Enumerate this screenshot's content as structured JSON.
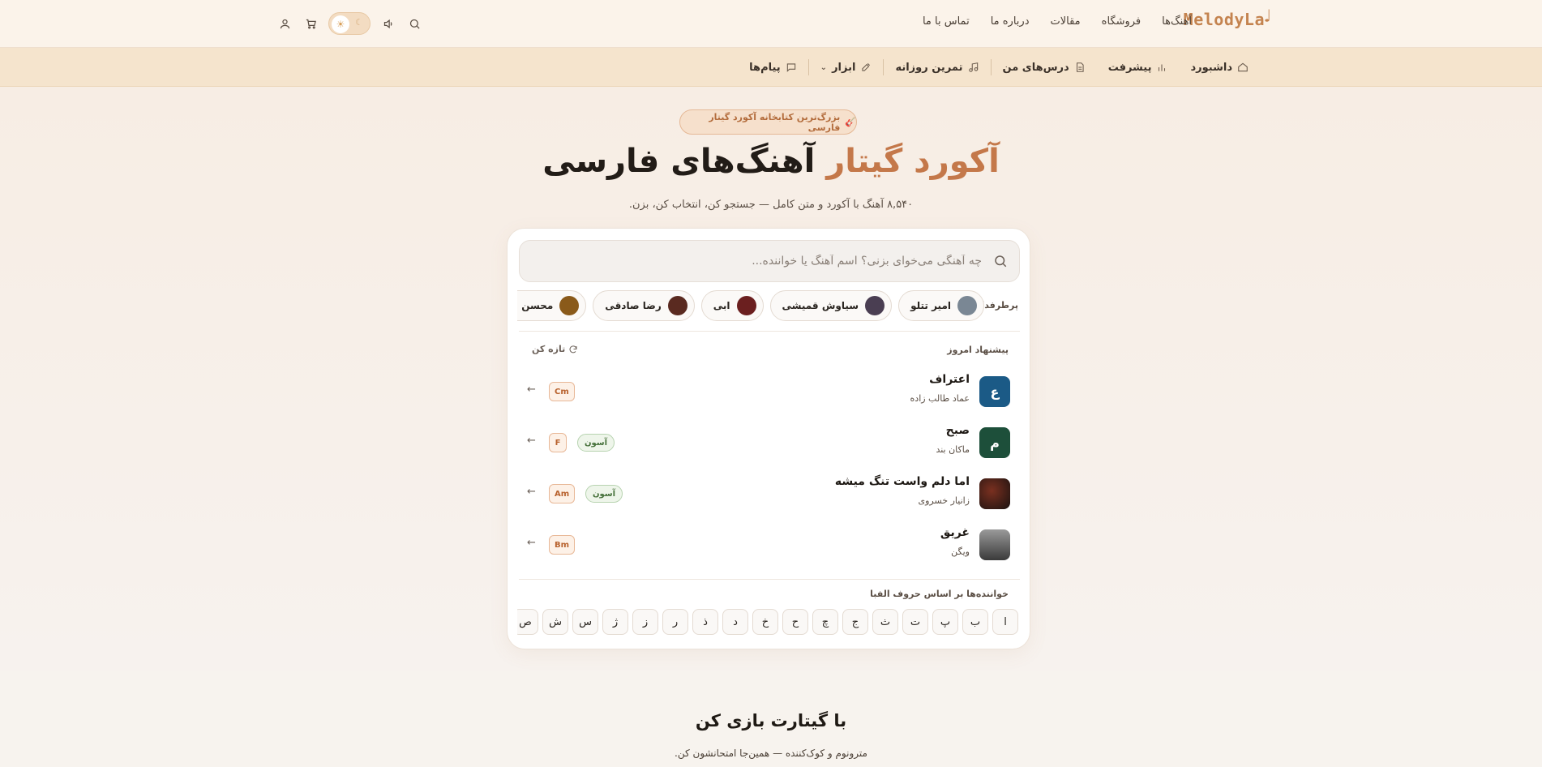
{
  "brand": {
    "logo_text": "MelodyLa",
    "accent": "#c4784a"
  },
  "topnav": [
    "آهنگ‌ها",
    "فروشگاه",
    "مقالات",
    "درباره ما",
    "تماس با ما"
  ],
  "topicons": [
    "search-icon",
    "volume-icon",
    "theme-toggle",
    "cart-icon",
    "user-icon"
  ],
  "subnav": {
    "dashboard": "داشبورد",
    "progress": "پیشرفت",
    "my_lessons": "درس‌های من",
    "daily_practice": "تمرین روزانه",
    "tools": "ابزار",
    "messages": "پیام‌ها"
  },
  "hero": {
    "badge": "بزرگ‌ترین کتابخانه آکورد گیتار فارسی",
    "title_accent": "آکورد گیتار",
    "title_rest": "آهنگ‌های فارسی",
    "subtitle": "۸,۵۴۰ آهنگ با آکورد و متن کامل — جستجو کن، انتخاب کن، بزن."
  },
  "search": {
    "placeholder": "چه آهنگی می‌خوای بزنی؟ اسم آهنگ یا خواننده..."
  },
  "popular": {
    "label": "پرطرفدار:",
    "artists": [
      "امیر تتلو",
      "سیاوش قمیشی",
      "ابی",
      "رضا صادقی",
      "محسن چاوشی"
    ]
  },
  "suggestions": {
    "label": "پیشنهاد امروز",
    "refresh": "تازه کن",
    "songs": [
      {
        "initial": "ع",
        "title": "اعتراف",
        "artist": "عماد طالب زاده",
        "chord": "Cm",
        "difficulty": "",
        "color": "#1b5a86"
      },
      {
        "initial": "م",
        "title": "صبح",
        "artist": "ماکان بند",
        "chord": "F",
        "difficulty": "آسون",
        "color": "#1d4f3a"
      },
      {
        "initial": "",
        "title": "اما دلم واست تنگ میشه",
        "artist": "زانیار خسروی",
        "chord": "Am",
        "difficulty": "آسون",
        "color": "#2a1c18"
      },
      {
        "initial": "",
        "title": "غریق",
        "artist": "ویگن",
        "chord": "Bm",
        "difficulty": "",
        "color": "#6a6a6a"
      }
    ],
    "arrow": "←"
  },
  "alphabet": {
    "label": "خواننده‌ها بر اساس حروف الفبا",
    "letters": [
      "ا",
      "ب",
      "پ",
      "ت",
      "ث",
      "ج",
      "چ",
      "ح",
      "خ",
      "د",
      "ذ",
      "ر",
      "ز",
      "ژ",
      "س",
      "ش",
      "ص"
    ]
  },
  "section": {
    "title": "با گیتارت بازی کن",
    "subtitle": "مترونوم و کوک‌کننده — همین‌جا امتحانشون کن."
  }
}
